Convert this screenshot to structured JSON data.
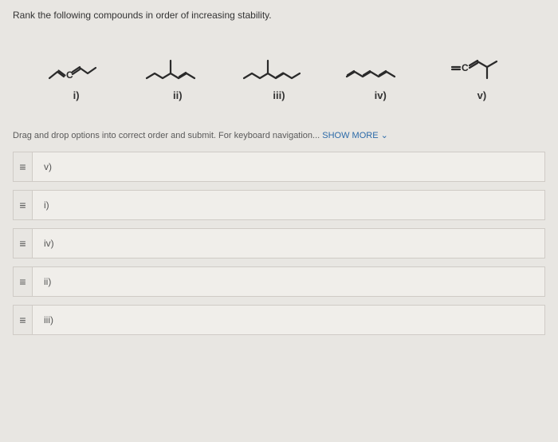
{
  "question": {
    "title": "Rank the following compounds in order of increasing stability."
  },
  "compounds": {
    "labels": [
      "i)",
      "ii)",
      "iii)",
      "iv)",
      "v)"
    ]
  },
  "instructions": {
    "text": "Drag and drop options into correct order and submit. For keyboard navigation...",
    "show_more": "SHOW MORE ⌄"
  },
  "answers": {
    "items": [
      {
        "value": "v)"
      },
      {
        "value": "i)"
      },
      {
        "value": "iv)"
      },
      {
        "value": "ii)"
      },
      {
        "value": "iii)"
      }
    ]
  }
}
